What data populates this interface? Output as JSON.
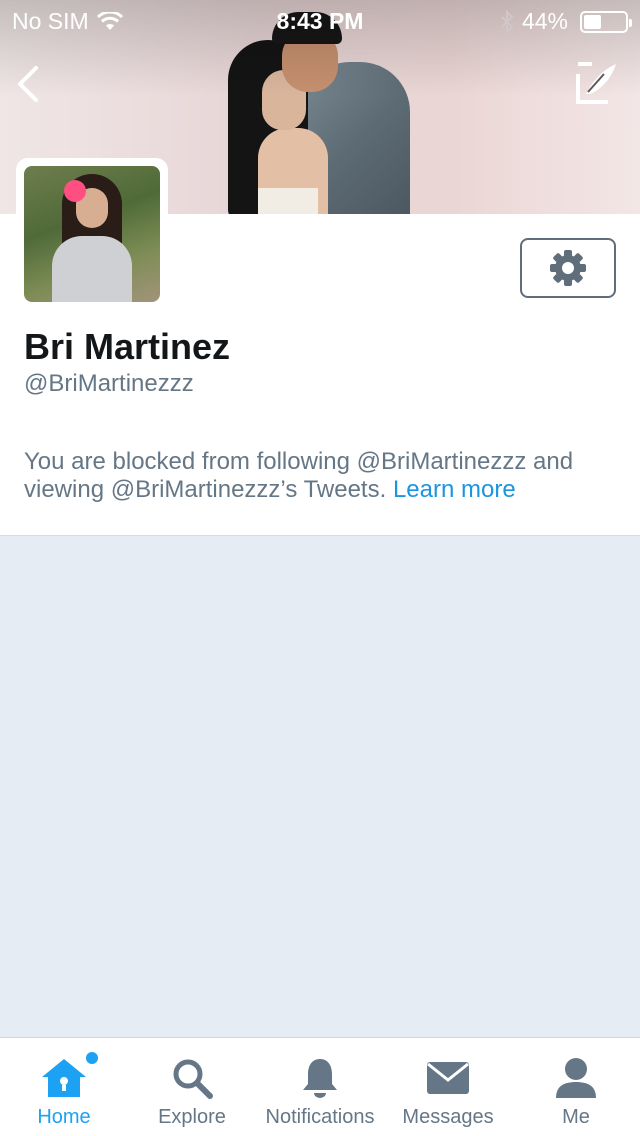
{
  "status_bar": {
    "carrier": "No SIM",
    "time": "8:43 PM",
    "battery_percent": "44%",
    "battery_level": 0.44,
    "icons": [
      "wifi-icon",
      "bluetooth-icon",
      "battery-icon"
    ]
  },
  "navigation": {
    "back_icon": "chevron-left-icon",
    "compose_icon": "compose-tweet-icon"
  },
  "profile": {
    "name": "Bri Martinez",
    "handle": "@BriMartinezzz",
    "blocked_message": "You are blocked from following @BriMartinezzz and viewing @BriMartinezzz’s Tweets.",
    "learn_more": "Learn more",
    "settings_icon": "gear-icon"
  },
  "tab_bar": {
    "active": "Home",
    "accent_color": "#1da1f2",
    "items": [
      {
        "label": "Home",
        "icon": "home-icon"
      },
      {
        "label": "Explore",
        "icon": "search-icon"
      },
      {
        "label": "Notifications",
        "icon": "bell-icon"
      },
      {
        "label": "Messages",
        "icon": "envelope-icon"
      },
      {
        "label": "Me",
        "icon": "person-icon"
      }
    ]
  }
}
